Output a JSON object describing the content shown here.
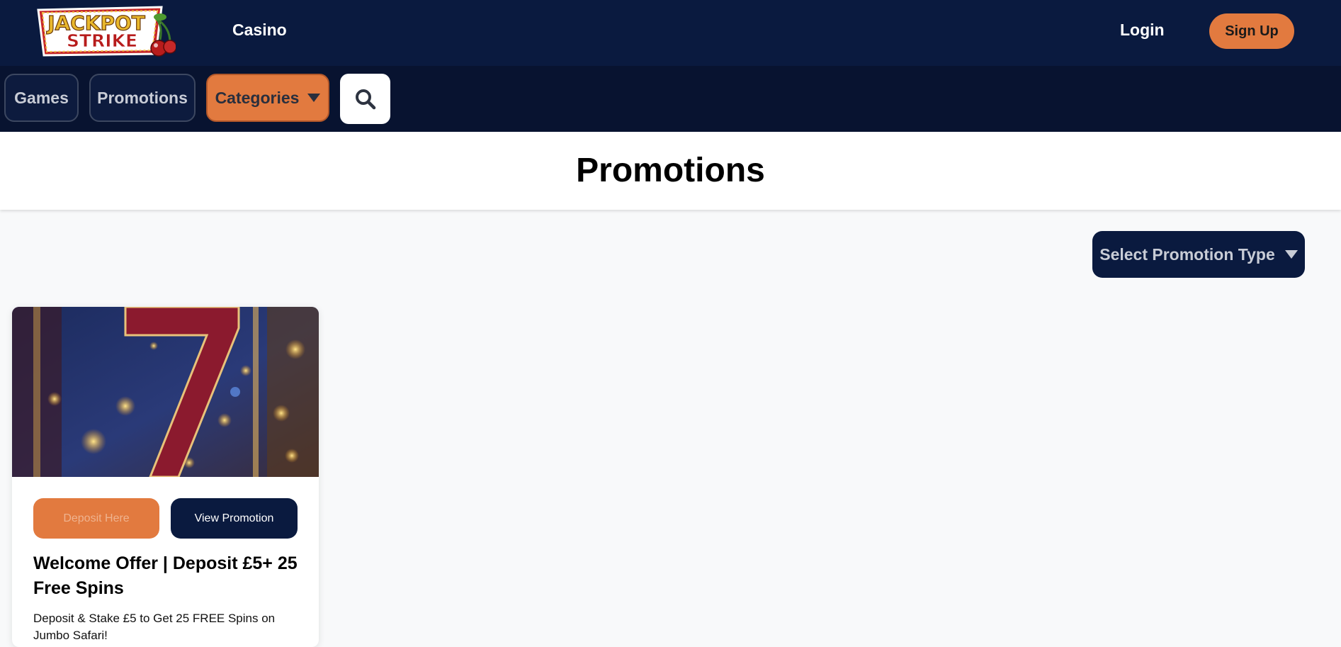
{
  "brand": {
    "logo_line1": "JACKPOT",
    "logo_line2": "STRIKE",
    "primary_color": "#0a1a3f",
    "accent_color": "#e27a3f"
  },
  "header": {
    "casino_label": "Casino",
    "login_label": "Login",
    "signup_label": "Sign Up"
  },
  "subnav": {
    "games_label": "Games",
    "promotions_label": "Promotions",
    "categories_label": "Categories",
    "search_icon": "search-icon"
  },
  "page": {
    "title": "Promotions",
    "filter_label": "Select Promotion Type"
  },
  "promotions": [
    {
      "image": "slot-machine-lucky-seven",
      "deposit_label": "Deposit Here",
      "view_label": "View Promotion",
      "title": "Welcome Offer | Deposit £5+ 25 Free Spins",
      "description": "Deposit & Stake £5 to Get 25 FREE Spins on Jumbo Safari!"
    }
  ]
}
